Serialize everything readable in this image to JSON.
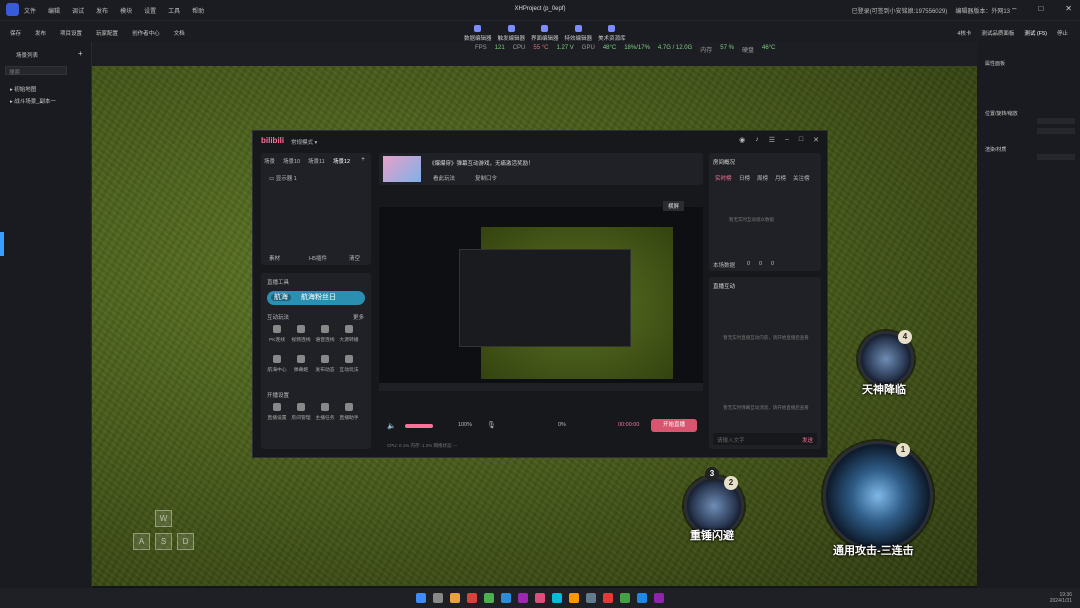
{
  "menubar": {
    "items": [
      "文件",
      "编辑",
      "调试",
      "发布",
      "模块",
      "设置",
      "工具",
      "帮助"
    ],
    "title": "XHProject (p_0epf)",
    "status": "已登录(可签到小安铭娘:197556029)",
    "version": "编辑器版本：外网13"
  },
  "toolbar": {
    "left": [
      "保存",
      "发布",
      "项目设置",
      "玩家配置",
      "创作者中心",
      "文档"
    ],
    "center": [
      "数据编辑器",
      "触发编辑器",
      "界面编辑器",
      "特效编辑器",
      "美术资源库"
    ],
    "right": [
      "4核卡",
      "测试品质面板",
      "测试 (F5)",
      "停止"
    ]
  },
  "stats": {
    "fps_label": "FPS",
    "fps": "121",
    "cpu_label": "CPU",
    "cpu_temp": "55 °C",
    "cpu_volt": "1.27 V",
    "gpu_label": "GPU",
    "gpu_temp": "48°C",
    "gpu_use": "18%/17%",
    "gpu_mem": "4.7G / 12.0G",
    "ram_label": "内存",
    "ram": "57 %",
    "disk_label": "硬盘",
    "disk": "46°C"
  },
  "left_panel": {
    "header": "场景列表",
    "search_placeholder": "搜索",
    "items": [
      "初始地图",
      "战斗场景_副本一"
    ]
  },
  "right_panel": {
    "sections": [
      "属性面板",
      "位置/旋转/缩放",
      "渲染/材质"
    ]
  },
  "bilibili": {
    "logo": "bilibili",
    "mode": "常规模式",
    "scene_tabs": [
      "场景",
      "场景10",
      "场景11",
      "场景12"
    ],
    "source_item": "显示器 1",
    "scene_actions": [
      "素材",
      "H5插件",
      "清空"
    ],
    "promo_title": "《爆爆穿》弹幕互动游戏，无痛激活奖励！",
    "promo_btns": [
      "看此玩法",
      "复制口令"
    ],
    "preview_btn": "横屏",
    "tools_header": "直播工具",
    "banner_tag": "航海",
    "banner_text": "航海粉丝日",
    "interactive_label": "互动玩法",
    "more": "更多",
    "tools_row1": [
      "PK连线",
      "视频连线",
      "语音连线",
      "大源转播"
    ],
    "tools_row2": [
      "航海中心",
      "弹幕姬",
      "发布动态",
      "互动玩法"
    ],
    "open_label": "开播设置",
    "tools_row3": [
      "直播设置",
      "房间管理",
      "主播任务",
      "直播助手"
    ],
    "room_label": "房间概况",
    "room_tabs": [
      "实时榜",
      "日榜",
      "周榜",
      "月榜",
      "关注榜"
    ],
    "room_empty": "暂无实时互动观众数据",
    "room_stats": "本场数据",
    "room_nums": [
      "0",
      "0",
      "0"
    ],
    "interact_label": "直播互动",
    "interact_empty": "暂无实时直播互动内容，请开始直播后查看",
    "chat_empty": "暂无实时弹幕互动消息，请开始直播后查看",
    "input_placeholder": "请输入文字",
    "send": "发送",
    "volume": "100%",
    "mic_vol": "0%",
    "timer": "00:00:00",
    "start_btn": "开始直播",
    "status_bar": "CPU: 0.1%   内存: 1.2%   网络状态: --"
  },
  "skills": {
    "skill1": {
      "label": "天神降临",
      "count": "4"
    },
    "skill2": {
      "label": "重锤闪避",
      "count": "2",
      "count2": "3"
    },
    "skill3": {
      "label": "通用攻击-三连击",
      "count": "1"
    }
  },
  "keys": [
    "W",
    "A",
    "S",
    "D"
  ],
  "tray": {
    "time": "19:36",
    "date": "2024/1/31"
  }
}
